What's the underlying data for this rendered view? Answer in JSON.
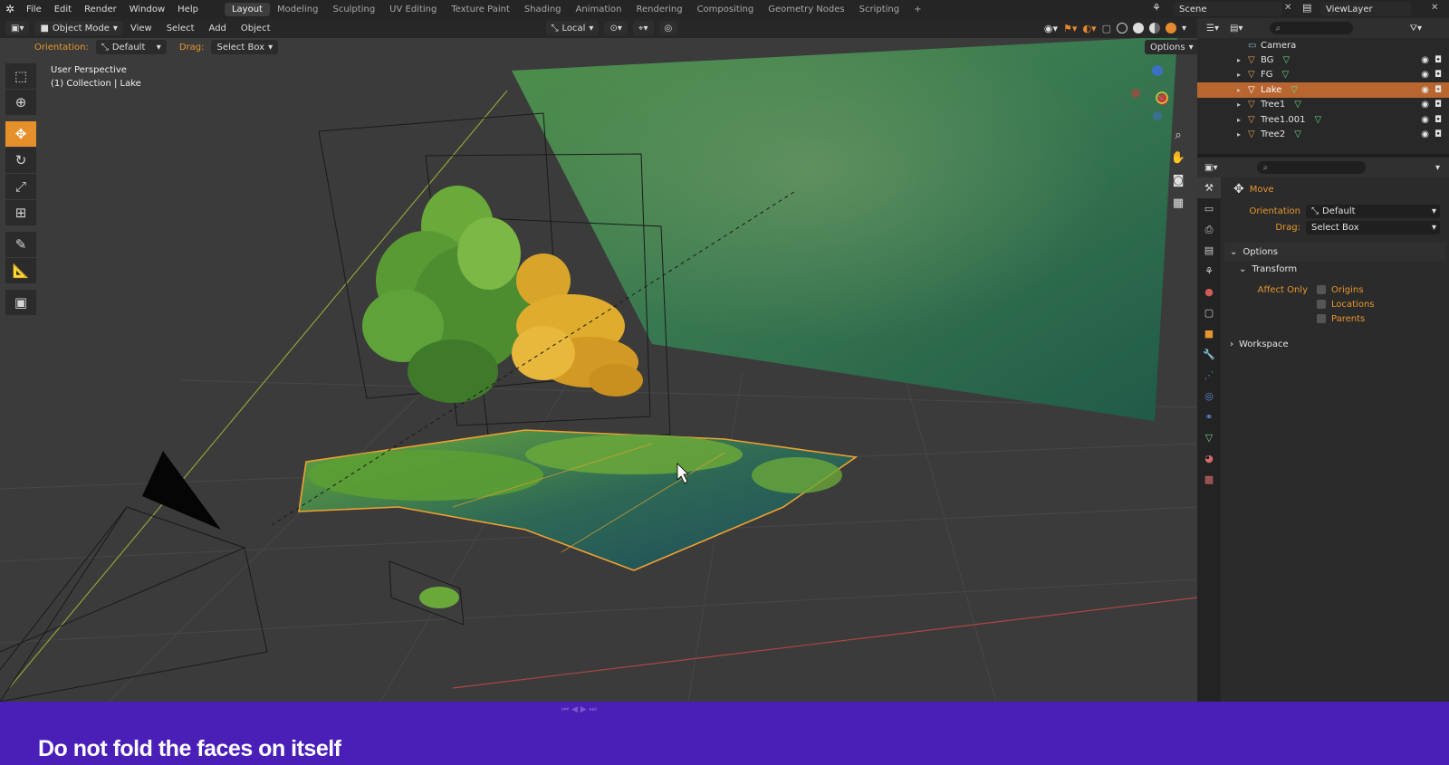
{
  "menu": {
    "items": [
      "File",
      "Edit",
      "Render",
      "Window",
      "Help"
    ],
    "workspaces": [
      "Layout",
      "Modeling",
      "Sculpting",
      "UV Editing",
      "Texture Paint",
      "Shading",
      "Animation",
      "Rendering",
      "Compositing",
      "Geometry Nodes",
      "Scripting",
      "+"
    ],
    "active_workspace": "Layout",
    "scene": "Scene",
    "view_layer": "ViewLayer"
  },
  "viewport": {
    "mode": "Object Mode",
    "menus": [
      "View",
      "Select",
      "Add",
      "Object"
    ],
    "transform_space": "Local",
    "orientation_label": "Orientation:",
    "orientation_value": "Default",
    "drag_label": "Drag:",
    "drag_value": "Select Box",
    "options_label": "Options",
    "info_line1": "User Perspective",
    "info_line2": "(1) Collection | Lake"
  },
  "outliner": {
    "items": [
      {
        "name": "Camera",
        "selected": false
      },
      {
        "name": "BG",
        "selected": false
      },
      {
        "name": "FG",
        "selected": false
      },
      {
        "name": "Lake",
        "selected": true
      },
      {
        "name": "Tree1",
        "selected": false
      },
      {
        "name": "Tree1.001",
        "selected": false
      },
      {
        "name": "Tree2",
        "selected": false
      }
    ]
  },
  "properties": {
    "tool_name": "Move",
    "orientation_label": "Orientation",
    "orientation_value": "Default",
    "drag_label": "Drag:",
    "drag_value": "Select Box",
    "options_panel": "Options",
    "transform_panel": "Transform",
    "affect_only_label": "Affect Only",
    "affect_only_options": [
      "Origins",
      "Locations",
      "Parents"
    ],
    "workspace_panel": "Workspace"
  },
  "caption": "Do not fold the faces on itself",
  "colors": {
    "accent": "#e6902c",
    "selection": "#b9652f",
    "caption_band": "#4a1fb8"
  }
}
